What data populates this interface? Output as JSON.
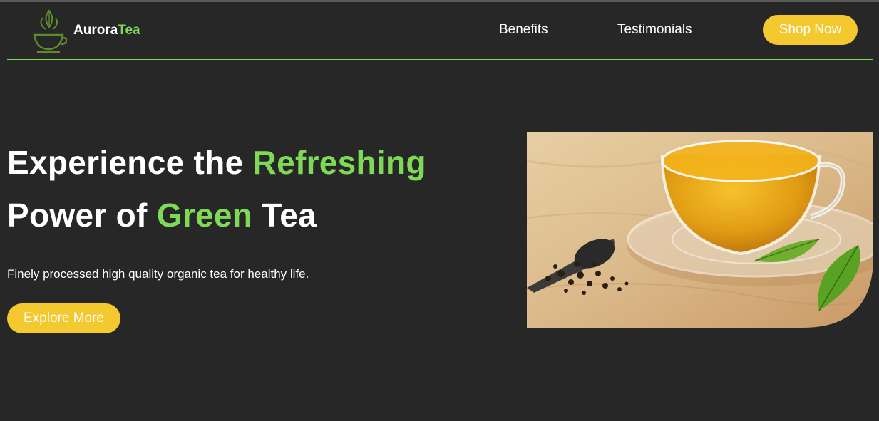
{
  "brand": {
    "name_part1": "Aurora",
    "name_part2": "Tea"
  },
  "nav": {
    "benefits": "Benefits",
    "testimonials": "Testimonials",
    "shop_now": "Shop Now"
  },
  "hero": {
    "title_line1_a": "Experience the ",
    "title_line1_b": "Refreshing",
    "title_line2_a": "Power of ",
    "title_line2_b": "Green",
    "title_line2_c": " Tea",
    "subtitle": "Finely processed high quality organic tea for healthy life.",
    "cta": "Explore More",
    "image_icon": "tea-cup-photo"
  },
  "colors": {
    "background": "#272727",
    "accent_green": "#7ed957",
    "button_yellow": "#f4c92f",
    "text": "#ffffff"
  }
}
